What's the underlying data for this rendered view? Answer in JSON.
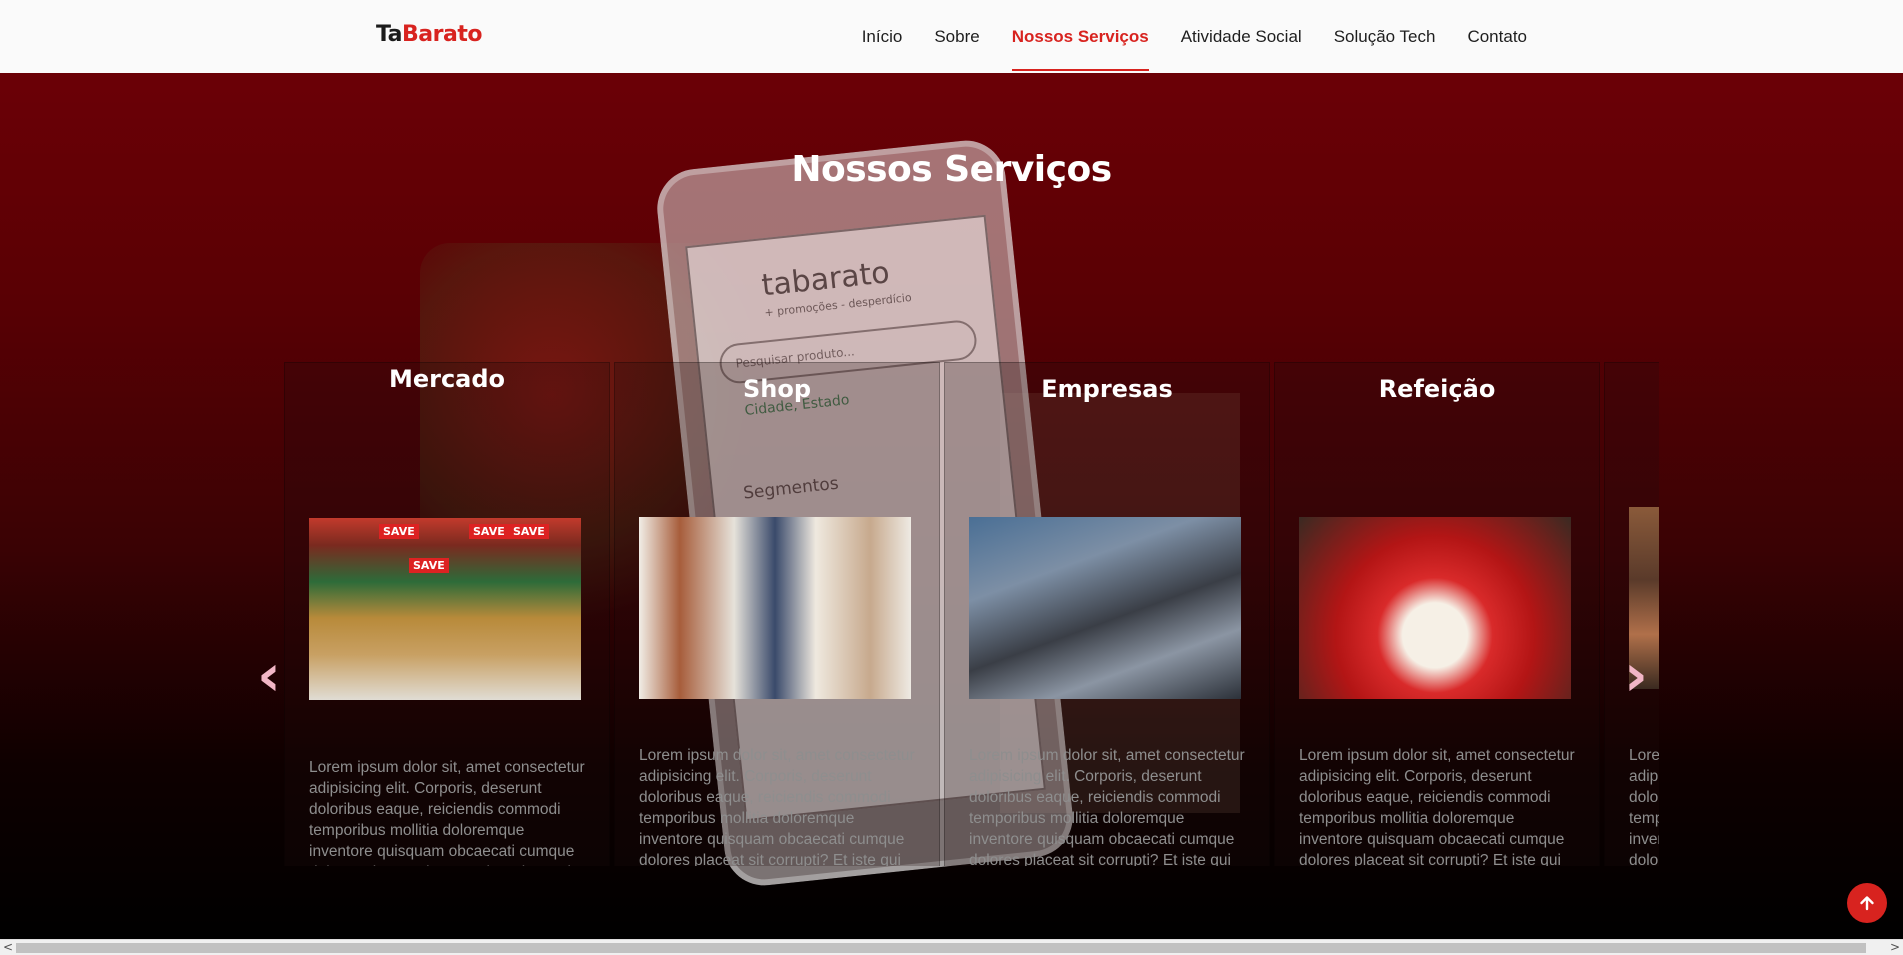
{
  "header": {
    "logo_part1": "Ta",
    "logo_part2": "Barato",
    "nav": [
      {
        "label": "Início"
      },
      {
        "label": "Sobre"
      },
      {
        "label": "Nossos Serviços",
        "active": true
      },
      {
        "label": "Atividade Social"
      },
      {
        "label": "Solução Tech"
      },
      {
        "label": "Contato"
      }
    ]
  },
  "hero": {
    "title": "Nossos Serviços",
    "background_phone": {
      "brand": "tabarato",
      "tagline": "+ promoções - desperdício",
      "search_placeholder": "Pesquisar produto...",
      "location": "Cidade, Estado",
      "section": "Segmentos"
    }
  },
  "cards": [
    {
      "title": "Mercado",
      "image": "supermarket-produce-photo",
      "text": "Lorem ipsum dolor sit, amet consectetur adipisicing elit. Corporis, deserunt doloribus eaque, reiciendis commodi temporibus mollitia doloremque inventore quisquam obcaecati cumque dolores placeat sit corrupti? Et iste qui placeat amet?"
    },
    {
      "title": "Shop",
      "image": "clothing-shop-photo",
      "text": "Lorem ipsum dolor sit, amet consectetur adipisicing elit. Corporis, deserunt doloribus eaque, reiciendis commodi temporibus mollitia doloremque inventore quisquam obcaecati cumque dolores placeat sit corrupti? Et iste qui placeat amet?"
    },
    {
      "title": "Empresas",
      "image": "laptop-teamwork-photo",
      "text": "Lorem ipsum dolor sit, amet consectetur adipisicing elit. Corporis, deserunt doloribus eaque, reiciendis commodi temporibus mollitia doloremque inventore quisquam obcaecati cumque dolores placeat sit corrupti? Et iste qui placeat amet?"
    },
    {
      "title": "Refeição",
      "image": "plated-meal-photo",
      "text": "Lorem ipsum dolor sit, amet consectetur adipisicing elit. Corporis, deserunt doloribus eaque, reiciendis commodi temporibus mollitia doloremque inventore quisquam obcaecati cumque dolores placeat sit corrupti? Et iste qui placeat amet?"
    },
    {
      "title": "",
      "image": "restaurant-interior-photo",
      "text": "Lorem ipsum dolor sit, amet consectetur adipisicing elit. Corporis, deserunt doloribus eaque, reiciendis commodi temporibus mollitia doloremque inventore quisquam obcaecati cumque dolores placeat sit corrupti? Et iste qui placeat amet?"
    }
  ],
  "mercado_signs": [
    "SAVE",
    "SAVE",
    "SAVE",
    "SAVE"
  ],
  "controls": {
    "prev_icon": "chevron-left-icon",
    "next_icon": "chevron-right-icon",
    "prev_glyph": "‹",
    "next_glyph": "›",
    "back_to_top_icon": "arrow-up-icon"
  },
  "scrollbar": {
    "left_glyph": "<",
    "right_glyph": ">"
  },
  "colors": {
    "brand_red": "#d8231f",
    "hero_top": "#6b0006",
    "arrow": "#f2b6c6"
  }
}
